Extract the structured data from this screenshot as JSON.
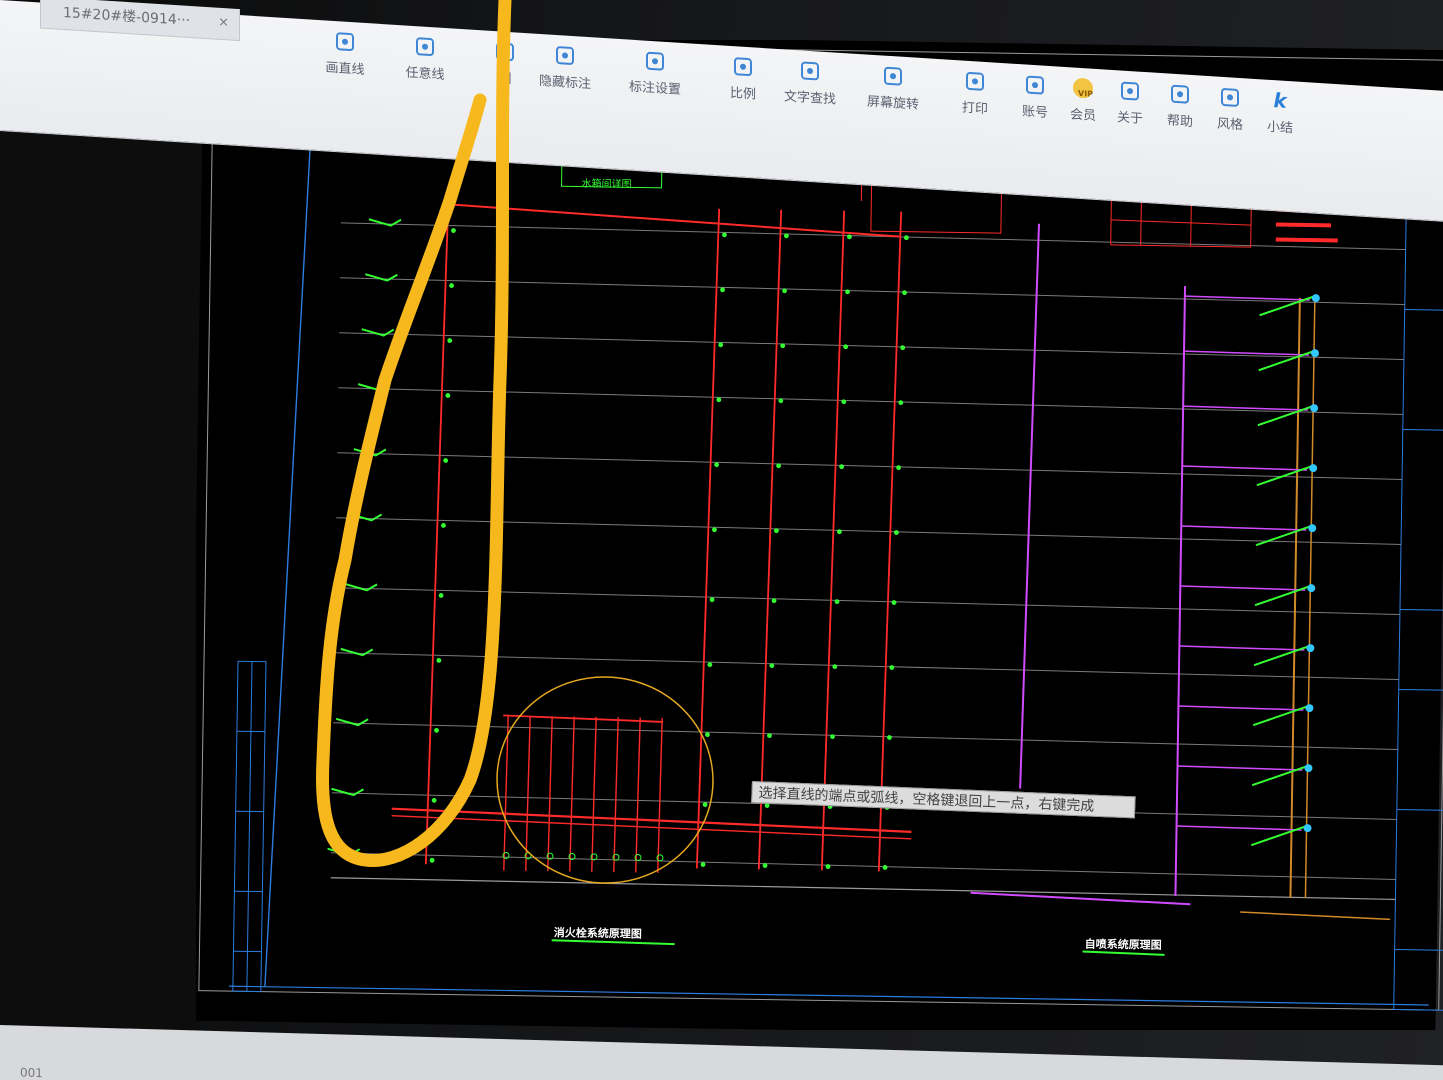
{
  "app": {
    "tab_title": "15#20#楼-0914···",
    "tab_close": "×",
    "status_text": "001"
  },
  "toolbar": {
    "items": [
      {
        "label": "画直线",
        "icon": "line-icon"
      },
      {
        "label": "任意线",
        "icon": "freehand-icon"
      },
      {
        "label": "删",
        "icon": "delete-icon"
      },
      {
        "label": "隐藏标注",
        "icon": "hide-annotation-icon"
      },
      {
        "label": "标注设置",
        "icon": "annotation-settings-icon"
      },
      {
        "label": "比例",
        "icon": "scale-icon"
      },
      {
        "label": "文字查找",
        "icon": "text-search-icon"
      },
      {
        "label": "屏幕旋转",
        "icon": "rotate-screen-icon"
      },
      {
        "label": "打印",
        "icon": "print-icon"
      },
      {
        "label": "账号",
        "icon": "account-icon"
      },
      {
        "label": "会员",
        "icon": "vip-icon",
        "badge": "VIP"
      },
      {
        "label": "关于",
        "icon": "info-icon"
      },
      {
        "label": "帮助",
        "icon": "help-icon"
      },
      {
        "label": "风格",
        "icon": "style-icon"
      },
      {
        "label": "小结",
        "icon": "summary-icon",
        "glyph": "k"
      }
    ]
  },
  "drawing": {
    "fire_system_title": "消火栓系统原理图",
    "water_system_title": "自喷系统原理图",
    "tank_label": "水箱间详图",
    "hint": "选择直线的端点或弧线，空格键退回上一点，右键完成"
  },
  "colors": {
    "toolbar_bg": "#eceef1",
    "cad_bg": "#000000",
    "fire_pipe": "#ff2a2a",
    "annotation": "#33ff33",
    "sprinkler_pipe": "#d24cff",
    "supply_pipe": "#d08a2a",
    "frame": "#2d7de0",
    "highlighter": "#f6b81c",
    "thin_circle": "#e6a81e"
  }
}
